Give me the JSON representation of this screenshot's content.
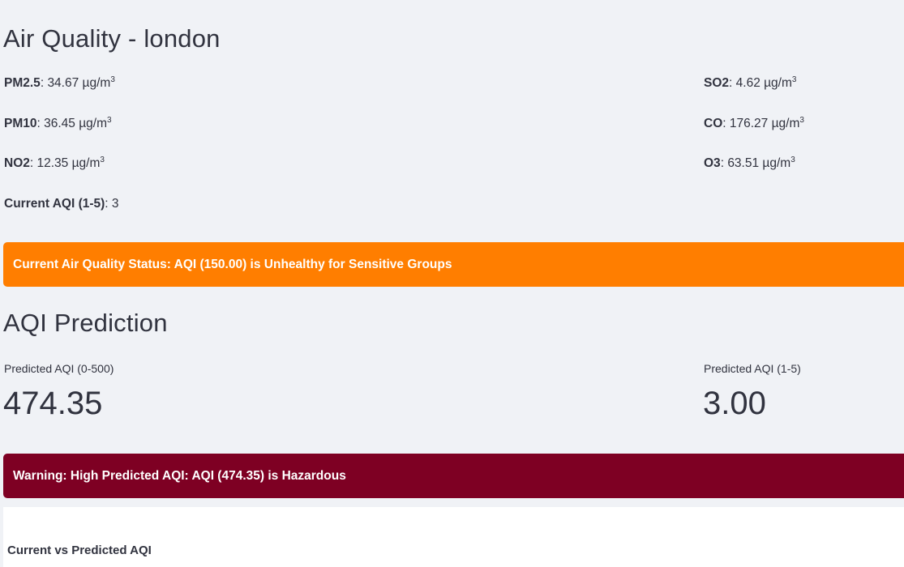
{
  "page": {
    "title": "Air Quality - london"
  },
  "pollutants": {
    "pm25": {
      "label": "PM2.5",
      "value": "34.67",
      "unit": "µg/m",
      "exp": "3"
    },
    "pm10": {
      "label": "PM10",
      "value": "36.45",
      "unit": "µg/m",
      "exp": "3"
    },
    "no2": {
      "label": "NO2",
      "value": "12.35",
      "unit": "µg/m",
      "exp": "3"
    },
    "so2": {
      "label": "SO2",
      "value": "4.62",
      "unit": "µg/m",
      "exp": "3"
    },
    "co": {
      "label": "CO",
      "value": "176.27",
      "unit": "µg/m",
      "exp": "3"
    },
    "o3": {
      "label": "O3",
      "value": "63.51",
      "unit": "µg/m",
      "exp": "3"
    }
  },
  "current_aqi": {
    "label": "Current AQI (1-5)",
    "value": "3"
  },
  "status_alert": {
    "text": "Current Air Quality Status: AQI (150.00) is Unhealthy for Sensitive Groups",
    "color": "#ff7e00"
  },
  "prediction": {
    "title": "AQI Prediction",
    "metric_0_500": {
      "label": "Predicted AQI (0-500)",
      "value": "474.35"
    },
    "metric_1_5": {
      "label": "Predicted AQI (1-5)",
      "value": "3.00"
    }
  },
  "warning_alert": {
    "text": "Warning: High Predicted AQI: AQI (474.35) is Hazardous",
    "color": "#7e0023"
  },
  "chart": {
    "title": "Current vs Predicted AQI"
  },
  "colors": {
    "background": "#f0f2f6",
    "text": "#31333f"
  }
}
